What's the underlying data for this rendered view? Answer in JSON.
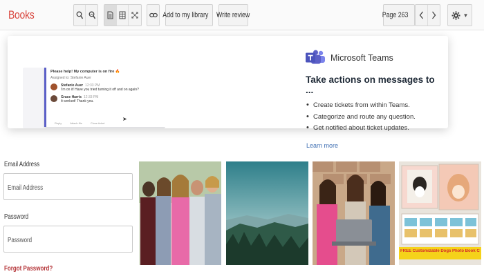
{
  "app": {
    "brand": "Books"
  },
  "toolbar": {
    "add_library_label": "Add to my library",
    "write_review_label": "Write review",
    "page_label": "Page 263"
  },
  "ad": {
    "product_name": "Microsoft Teams",
    "headline": "Take actions on messages to ...",
    "bullets": [
      "Create tickets from within Teams.",
      "Categorize and route any question.",
      "Get notified about ticket updates."
    ],
    "learn_more": "Learn more",
    "chat": {
      "title": "Please help! My computer is on fire 🔥",
      "assigned": "Assigned to: Stefanie Auer",
      "messages": [
        {
          "author": "Stefanie Auer",
          "time": "12:33 PM",
          "text": "I'm on it! Have you tried turning it off and on again?"
        },
        {
          "author": "Grace Harris",
          "time": "12:33 PM",
          "text": "It worked! Thank you."
        }
      ],
      "footer_actions": [
        "Reply",
        "Attach file",
        "Close ticket"
      ]
    }
  },
  "login": {
    "email_label": "Email Address",
    "email_placeholder": "Email Address",
    "password_label": "Password",
    "password_placeholder": "Password",
    "forgot_label": "Forgot Password?"
  },
  "tiles": {
    "calendar_caption": "FREE Customizable Dogs Photo Book Calendar"
  },
  "colors": {
    "brand": "#d9473f",
    "teams_purple": "#5b5fc7",
    "link": "#3f6fb3",
    "forgot": "#b5363a"
  }
}
